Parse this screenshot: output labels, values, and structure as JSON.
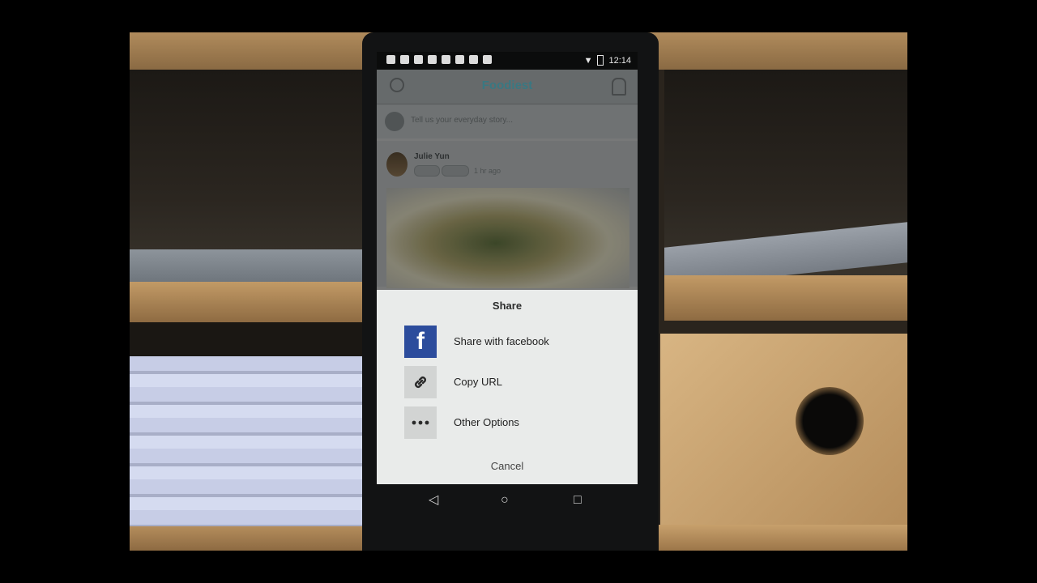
{
  "status_bar": {
    "time": "12:14"
  },
  "app": {
    "title": "Foodiest",
    "compose_placeholder": "Tell us your everyday story..."
  },
  "post": {
    "author": "Julie Yun",
    "time": "1 hr ago"
  },
  "share_sheet": {
    "title": "Share",
    "options": [
      {
        "label": "Share with facebook",
        "icon": "facebook-icon"
      },
      {
        "label": "Copy URL",
        "icon": "link-icon"
      },
      {
        "label": "Other Options",
        "icon": "more-dots-icon"
      }
    ],
    "cancel": "Cancel"
  },
  "nav": {
    "back": "◁",
    "home": "○",
    "recents": "□"
  },
  "colors": {
    "facebook_blue": "#2c4c9c",
    "sheet_bg": "#e9ebea",
    "brand_teal": "#3d7f8a"
  }
}
